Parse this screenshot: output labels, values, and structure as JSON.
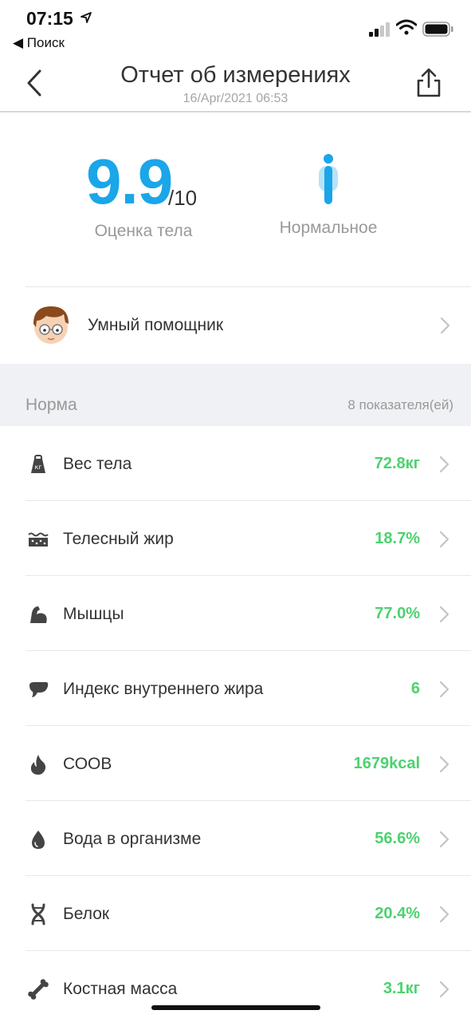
{
  "status_bar": {
    "time": "07:15",
    "back_app": "◀ Поиск"
  },
  "header": {
    "title": "Отчет об измерениях",
    "subtitle": "16/Apr/2021 06:53"
  },
  "score": {
    "value": "9.9",
    "denominator": "/10",
    "label": "Оценка тела",
    "body_type": "Нормальное"
  },
  "assistant": {
    "label": "Умный помощник"
  },
  "section": {
    "title": "Норма",
    "count": "8 показателя(ей)"
  },
  "metrics": [
    {
      "label": "Вес тела",
      "value": "72.8кг",
      "icon": "weight-icon"
    },
    {
      "label": "Телесный жир",
      "value": "18.7%",
      "icon": "body-fat-icon"
    },
    {
      "label": "Мышцы",
      "value": "77.0%",
      "icon": "muscle-icon"
    },
    {
      "label": "Индекс внутреннего жира",
      "value": "6",
      "icon": "visceral-fat-icon"
    },
    {
      "label": "СООВ",
      "value": "1679kcal",
      "icon": "flame-icon"
    },
    {
      "label": "Вода в организме",
      "value": "56.6%",
      "icon": "water-drop-icon"
    },
    {
      "label": "Белок",
      "value": "20.4%",
      "icon": "protein-dna-icon"
    },
    {
      "label": "Костная масса",
      "value": "3.1кг",
      "icon": "bone-icon"
    }
  ],
  "colors": {
    "accent": "#1aa6e8",
    "good_value": "#4cd26f"
  }
}
